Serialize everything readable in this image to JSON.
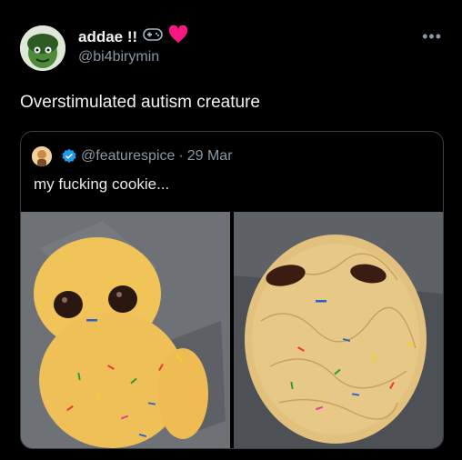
{
  "author": {
    "display_name": "addae !!",
    "handle": "@bi4birymin",
    "badge_icons": [
      "gamepad-icon",
      "heart-icon"
    ]
  },
  "more_label": "•••",
  "tweet": {
    "text": "Overstimulated autism creature"
  },
  "quote": {
    "handle": "@featurespice",
    "separator": "·",
    "date": "29 Mar",
    "text": "my fucking cookie...",
    "verified_icon": "verified-badge-icon"
  },
  "colors": {
    "background": "#000000",
    "primary_text": "#e7e9ea",
    "secondary_text": "#8b98a5",
    "border": "#3a3f44",
    "verified_blue": "#1d9bf0",
    "heart_red": "#f91880"
  }
}
